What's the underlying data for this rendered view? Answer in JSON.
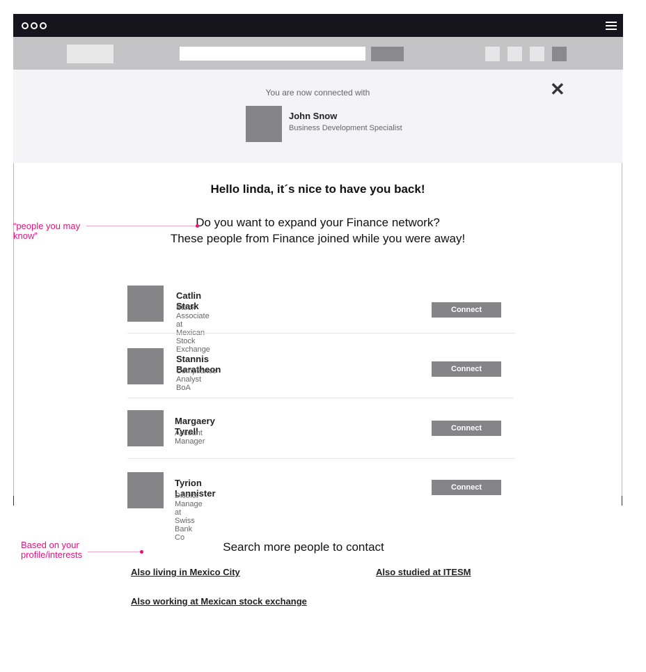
{
  "window": {
    "menu_icon": "hamburger-icon",
    "dots_icon": "window-dots-icon"
  },
  "notice": {
    "text": "You are now connected with",
    "close_icon": "close-icon",
    "close_glyph": "✕",
    "contact": {
      "name": "John Snow",
      "title": "Business Development Specialist"
    }
  },
  "main": {
    "greeting": "Hello linda, it´s nice to have you back!",
    "question_line1": "Do you want to expand your Finance network?",
    "question_line2": "These people from Finance joined while you were away!"
  },
  "annotations": {
    "people_note": "“people you may know”",
    "based_note": "Based on your profile/interests"
  },
  "people": [
    {
      "name": "Catlin Stark",
      "title": "Stock Associate at Mexican Stock Exchange",
      "button": "Connect"
    },
    {
      "name": "Stannis Baratheon",
      "title": "Compliance Analyst BoA",
      "button": "Connect"
    },
    {
      "name": "Margaery Tyrell",
      "title": "Account Manager",
      "button": "Connect"
    },
    {
      "name": "Tyrion Lannister",
      "title": "District Manage at  Swiss Bank Co",
      "button": "Connect"
    }
  ],
  "search_more": {
    "heading": "Search more people to contact",
    "links": [
      "Also living in Mexico City",
      "Also studied at ITESM",
      "Also working at Mexican stock exchange"
    ]
  },
  "colors": {
    "titlebar": "#16151e",
    "toolbar": "#c4c4c6",
    "placeholder": "#858587",
    "annotation": "#e8107f"
  }
}
